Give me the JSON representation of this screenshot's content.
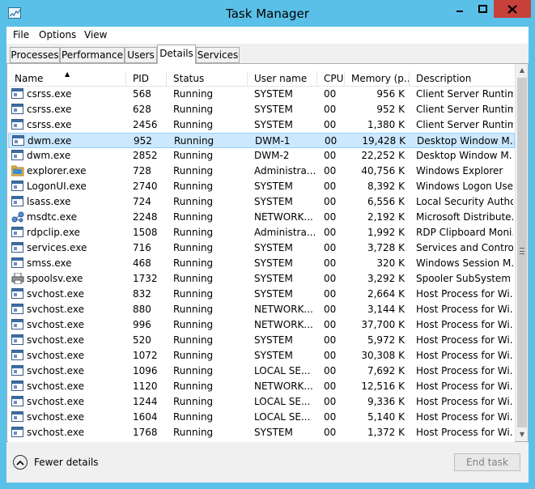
{
  "window": {
    "title": "Task Manager",
    "accent_color": "#5bc0e8",
    "close_color": "#c7403a"
  },
  "menu": [
    "File",
    "Options",
    "View"
  ],
  "tabs": [
    "Processes",
    "Performance",
    "Users",
    "Details",
    "Services"
  ],
  "active_tab": "Details",
  "columns": {
    "name": "Name",
    "pid": "PID",
    "status": "Status",
    "user": "User name",
    "cpu": "CPU",
    "memory": "Memory (p...",
    "description": "Description"
  },
  "sort": {
    "column": "Name",
    "icon": "sort-ascending-icon"
  },
  "rows": [
    {
      "icon": "exe-icon",
      "name": "csrss.exe",
      "pid": "568",
      "status": "Running",
      "user": "SYSTEM",
      "cpu": "00",
      "memory": "956 K",
      "description": "Client Server Runtim...",
      "selected": false
    },
    {
      "icon": "exe-icon",
      "name": "csrss.exe",
      "pid": "628",
      "status": "Running",
      "user": "SYSTEM",
      "cpu": "00",
      "memory": "952 K",
      "description": "Client Server Runtim...",
      "selected": false
    },
    {
      "icon": "exe-icon",
      "name": "csrss.exe",
      "pid": "2456",
      "status": "Running",
      "user": "SYSTEM",
      "cpu": "00",
      "memory": "1,380 K",
      "description": "Client Server Runtim...",
      "selected": false
    },
    {
      "icon": "exe-icon",
      "name": "dwm.exe",
      "pid": "952",
      "status": "Running",
      "user": "DWM-1",
      "cpu": "00",
      "memory": "19,428 K",
      "description": "Desktop Window M...",
      "selected": true
    },
    {
      "icon": "exe-icon",
      "name": "dwm.exe",
      "pid": "2852",
      "status": "Running",
      "user": "DWM-2",
      "cpu": "00",
      "memory": "22,252 K",
      "description": "Desktop Window M...",
      "selected": false
    },
    {
      "icon": "folder-icon",
      "name": "explorer.exe",
      "pid": "728",
      "status": "Running",
      "user": "Administra...",
      "cpu": "00",
      "memory": "40,756 K",
      "description": "Windows Explorer",
      "selected": false
    },
    {
      "icon": "exe-icon",
      "name": "LogonUI.exe",
      "pid": "2740",
      "status": "Running",
      "user": "SYSTEM",
      "cpu": "00",
      "memory": "8,392 K",
      "description": "Windows Logon Use...",
      "selected": false
    },
    {
      "icon": "exe-icon",
      "name": "lsass.exe",
      "pid": "724",
      "status": "Running",
      "user": "SYSTEM",
      "cpu": "00",
      "memory": "6,556 K",
      "description": "Local Security Autho...",
      "selected": false
    },
    {
      "icon": "network-icon",
      "name": "msdtc.exe",
      "pid": "2248",
      "status": "Running",
      "user": "NETWORK...",
      "cpu": "00",
      "memory": "2,192 K",
      "description": "Microsoft Distribute...",
      "selected": false
    },
    {
      "icon": "exe-icon",
      "name": "rdpclip.exe",
      "pid": "1508",
      "status": "Running",
      "user": "Administra...",
      "cpu": "00",
      "memory": "1,992 K",
      "description": "RDP Clipboard Moni...",
      "selected": false
    },
    {
      "icon": "exe-icon",
      "name": "services.exe",
      "pid": "716",
      "status": "Running",
      "user": "SYSTEM",
      "cpu": "00",
      "memory": "3,728 K",
      "description": "Services and Control...",
      "selected": false
    },
    {
      "icon": "exe-icon",
      "name": "smss.exe",
      "pid": "468",
      "status": "Running",
      "user": "SYSTEM",
      "cpu": "00",
      "memory": "320 K",
      "description": "Windows Session M...",
      "selected": false
    },
    {
      "icon": "printer-icon",
      "name": "spoolsv.exe",
      "pid": "1732",
      "status": "Running",
      "user": "SYSTEM",
      "cpu": "00",
      "memory": "3,292 K",
      "description": "Spooler SubSystem ...",
      "selected": false
    },
    {
      "icon": "exe-icon",
      "name": "svchost.exe",
      "pid": "832",
      "status": "Running",
      "user": "SYSTEM",
      "cpu": "00",
      "memory": "2,664 K",
      "description": "Host Process for Wi...",
      "selected": false
    },
    {
      "icon": "exe-icon",
      "name": "svchost.exe",
      "pid": "880",
      "status": "Running",
      "user": "NETWORK...",
      "cpu": "00",
      "memory": "3,144 K",
      "description": "Host Process for Wi...",
      "selected": false
    },
    {
      "icon": "exe-icon",
      "name": "svchost.exe",
      "pid": "996",
      "status": "Running",
      "user": "NETWORK...",
      "cpu": "00",
      "memory": "37,700 K",
      "description": "Host Process for Wi...",
      "selected": false
    },
    {
      "icon": "exe-icon",
      "name": "svchost.exe",
      "pid": "520",
      "status": "Running",
      "user": "SYSTEM",
      "cpu": "00",
      "memory": "5,972 K",
      "description": "Host Process for Wi...",
      "selected": false
    },
    {
      "icon": "exe-icon",
      "name": "svchost.exe",
      "pid": "1072",
      "status": "Running",
      "user": "SYSTEM",
      "cpu": "00",
      "memory": "30,308 K",
      "description": "Host Process for Wi...",
      "selected": false
    },
    {
      "icon": "exe-icon",
      "name": "svchost.exe",
      "pid": "1096",
      "status": "Running",
      "user": "LOCAL SE...",
      "cpu": "00",
      "memory": "7,692 K",
      "description": "Host Process for Wi...",
      "selected": false
    },
    {
      "icon": "exe-icon",
      "name": "svchost.exe",
      "pid": "1120",
      "status": "Running",
      "user": "NETWORK...",
      "cpu": "00",
      "memory": "12,516 K",
      "description": "Host Process for Wi...",
      "selected": false
    },
    {
      "icon": "exe-icon",
      "name": "svchost.exe",
      "pid": "1244",
      "status": "Running",
      "user": "LOCAL SE...",
      "cpu": "00",
      "memory": "9,336 K",
      "description": "Host Process for Wi...",
      "selected": false
    },
    {
      "icon": "exe-icon",
      "name": "svchost.exe",
      "pid": "1604",
      "status": "Running",
      "user": "LOCAL SE...",
      "cpu": "00",
      "memory": "5,140 K",
      "description": "Host Process for Wi...",
      "selected": false
    },
    {
      "icon": "exe-icon",
      "name": "svchost.exe",
      "pid": "1768",
      "status": "Running",
      "user": "SYSTEM",
      "cpu": "00",
      "memory": "1,372 K",
      "description": "Host Process for Wi...",
      "selected": false
    }
  ],
  "footer": {
    "fewer_details": "Fewer details",
    "end_task": "End task"
  }
}
